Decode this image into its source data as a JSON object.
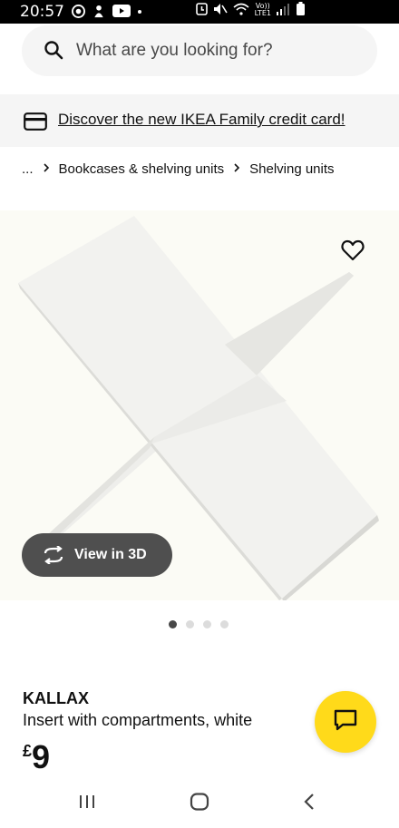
{
  "status_bar": {
    "time": "20:57",
    "network_top": "Vo))",
    "network_bottom": "LTE1"
  },
  "search": {
    "placeholder": "What are you looking for?"
  },
  "promo": {
    "text": "Discover the new IKEA Family credit card!"
  },
  "breadcrumb": {
    "ellipsis": "...",
    "items": [
      "Bookcases & shelving units",
      "Shelving units"
    ]
  },
  "gallery": {
    "view_3d_label": "View in 3D",
    "dot_count": 4,
    "active_index": 0
  },
  "product": {
    "name": "KALLAX",
    "description": "Insert with compartments, white",
    "currency": "£",
    "price": "9"
  },
  "colors": {
    "chat_button": "#ffda1a",
    "view3d_bg": "#4f4f4f",
    "image_bg": "#fbfbf5"
  }
}
